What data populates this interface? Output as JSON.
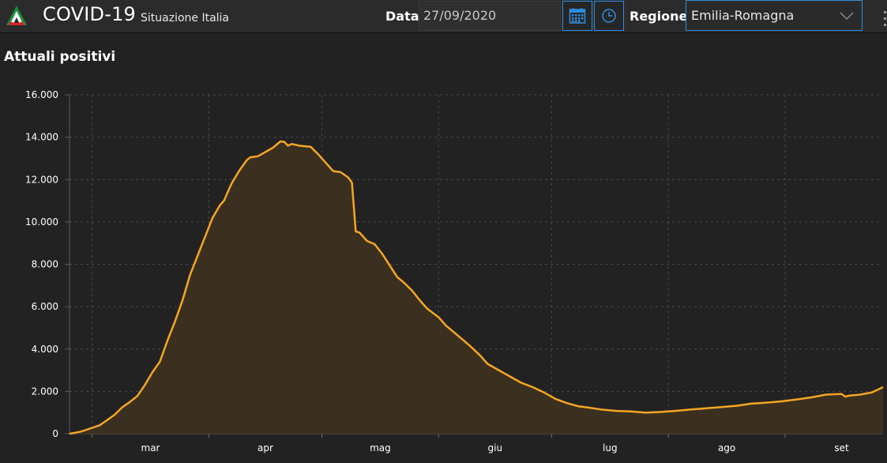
{
  "header": {
    "title": "COVID-19",
    "subtitle": "Situazione Italia",
    "date_label": "Data",
    "date_value": "27/09/2020",
    "region_label": "Regione",
    "region_value": "Emilia-Romagna"
  },
  "icons": {
    "logo": "italy-logo-icon",
    "calendar": "calendar-icon",
    "clock": "clock-icon",
    "dropdown": "chevron-down-icon",
    "more": "more-vertical-icon"
  },
  "colors": {
    "line": "#f5a623",
    "fill": "#3b3020",
    "background": "#232222",
    "accent": "#2f8fe0"
  },
  "chart_data": {
    "type": "area",
    "title": "Attuali positivi",
    "xlabel": "",
    "ylabel": "",
    "ylim": [
      0,
      16000
    ],
    "yticks": [
      0,
      2000,
      4000,
      6000,
      8000,
      10000,
      12000,
      14000,
      16000
    ],
    "ytick_labels": [
      "0",
      "2.000",
      "4.000",
      "6.000",
      "8.000",
      "10.000",
      "12.000",
      "14.000",
      "16.000"
    ],
    "month_labels": [
      "mar",
      "apr",
      "mag",
      "giu",
      "lug",
      "ago",
      "set"
    ],
    "x_start": "2020-02-24",
    "x_end": "2020-09-27",
    "grid": true,
    "series": [
      {
        "points": [
          [
            "2020-02-24",
            0
          ],
          [
            "2020-02-27",
            100
          ],
          [
            "2020-03-01",
            280
          ],
          [
            "2020-03-03",
            400
          ],
          [
            "2020-03-05",
            650
          ],
          [
            "2020-03-07",
            900
          ],
          [
            "2020-03-09",
            1250
          ],
          [
            "2020-03-11",
            1500
          ],
          [
            "2020-03-13",
            1780
          ],
          [
            "2020-03-15",
            2300
          ],
          [
            "2020-03-17",
            2900
          ],
          [
            "2020-03-19",
            3400
          ],
          [
            "2020-03-21",
            4400
          ],
          [
            "2020-03-23",
            5300
          ],
          [
            "2020-03-25",
            6300
          ],
          [
            "2020-03-27",
            7500
          ],
          [
            "2020-03-29",
            8400
          ],
          [
            "2020-03-31",
            9300
          ],
          [
            "2020-04-02",
            10200
          ],
          [
            "2020-04-04",
            10800
          ],
          [
            "2020-04-05",
            11000
          ],
          [
            "2020-04-07",
            11800
          ],
          [
            "2020-04-09",
            12400
          ],
          [
            "2020-04-11",
            12900
          ],
          [
            "2020-04-12",
            13050
          ],
          [
            "2020-04-14",
            13100
          ],
          [
            "2020-04-16",
            13300
          ],
          [
            "2020-04-18",
            13500
          ],
          [
            "2020-04-20",
            13800
          ],
          [
            "2020-04-21",
            13780
          ],
          [
            "2020-04-22",
            13600
          ],
          [
            "2020-04-23",
            13680
          ],
          [
            "2020-04-25",
            13600
          ],
          [
            "2020-04-28",
            13550
          ],
          [
            "2020-04-30",
            13200
          ],
          [
            "2020-05-02",
            12800
          ],
          [
            "2020-05-04",
            12400
          ],
          [
            "2020-05-06",
            12350
          ],
          [
            "2020-05-08",
            12100
          ],
          [
            "2020-05-09",
            11850
          ],
          [
            "2020-05-10",
            9550
          ],
          [
            "2020-05-11",
            9500
          ],
          [
            "2020-05-13",
            9100
          ],
          [
            "2020-05-15",
            8950
          ],
          [
            "2020-05-17",
            8500
          ],
          [
            "2020-05-19",
            7950
          ],
          [
            "2020-05-21",
            7400
          ],
          [
            "2020-05-23",
            7100
          ],
          [
            "2020-05-25",
            6750
          ],
          [
            "2020-05-27",
            6300
          ],
          [
            "2020-05-29",
            5900
          ],
          [
            "2020-06-01",
            5500
          ],
          [
            "2020-06-03",
            5100
          ],
          [
            "2020-06-06",
            4650
          ],
          [
            "2020-06-09",
            4200
          ],
          [
            "2020-06-12",
            3700
          ],
          [
            "2020-06-14",
            3300
          ],
          [
            "2020-06-17",
            3000
          ],
          [
            "2020-06-20",
            2700
          ],
          [
            "2020-06-23",
            2400
          ],
          [
            "2020-06-26",
            2200
          ],
          [
            "2020-06-29",
            1950
          ],
          [
            "2020-07-02",
            1650
          ],
          [
            "2020-07-05",
            1450
          ],
          [
            "2020-07-08",
            1300
          ],
          [
            "2020-07-11",
            1230
          ],
          [
            "2020-07-14",
            1150
          ],
          [
            "2020-07-18",
            1080
          ],
          [
            "2020-07-22",
            1050
          ],
          [
            "2020-07-26",
            1000
          ],
          [
            "2020-07-30",
            1030
          ],
          [
            "2020-08-03",
            1080
          ],
          [
            "2020-08-07",
            1150
          ],
          [
            "2020-08-11",
            1200
          ],
          [
            "2020-08-15",
            1260
          ],
          [
            "2020-08-19",
            1320
          ],
          [
            "2020-08-23",
            1420
          ],
          [
            "2020-08-27",
            1470
          ],
          [
            "2020-08-31",
            1530
          ],
          [
            "2020-09-04",
            1620
          ],
          [
            "2020-09-08",
            1720
          ],
          [
            "2020-09-12",
            1850
          ],
          [
            "2020-09-16",
            1880
          ],
          [
            "2020-09-17",
            1750
          ],
          [
            "2020-09-18",
            1800
          ],
          [
            "2020-09-21",
            1850
          ],
          [
            "2020-09-24",
            1950
          ],
          [
            "2020-09-27",
            2200
          ]
        ]
      }
    ]
  }
}
